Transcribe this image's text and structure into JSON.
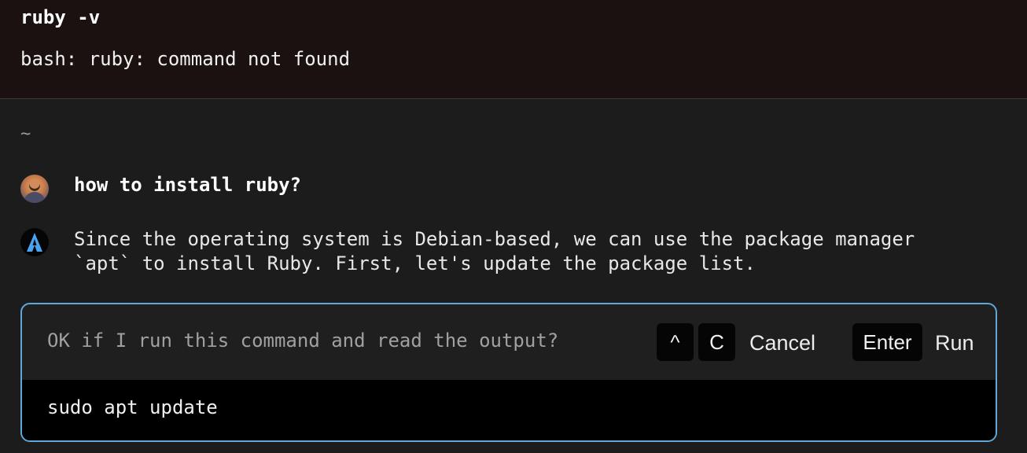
{
  "previous_block": {
    "command": "ruby -v",
    "output": "bash: ruby: command not found"
  },
  "cwd": "~",
  "conversation": {
    "user_message": "how to install ruby?",
    "ai_message": "Since the operating system is Debian-based, we can use the package manager\n`apt` to install Ruby. First, let's update the package list."
  },
  "permission_prompt": {
    "question": "OK if I run this command and read the output?",
    "cancel_keys": [
      "^",
      "C"
    ],
    "cancel_label": "Cancel",
    "run_key": "Enter",
    "run_label": "Run",
    "command": "sudo apt update"
  },
  "colors": {
    "accent_border": "#5fa8d9",
    "ai_icon": "#4aa3f0"
  }
}
